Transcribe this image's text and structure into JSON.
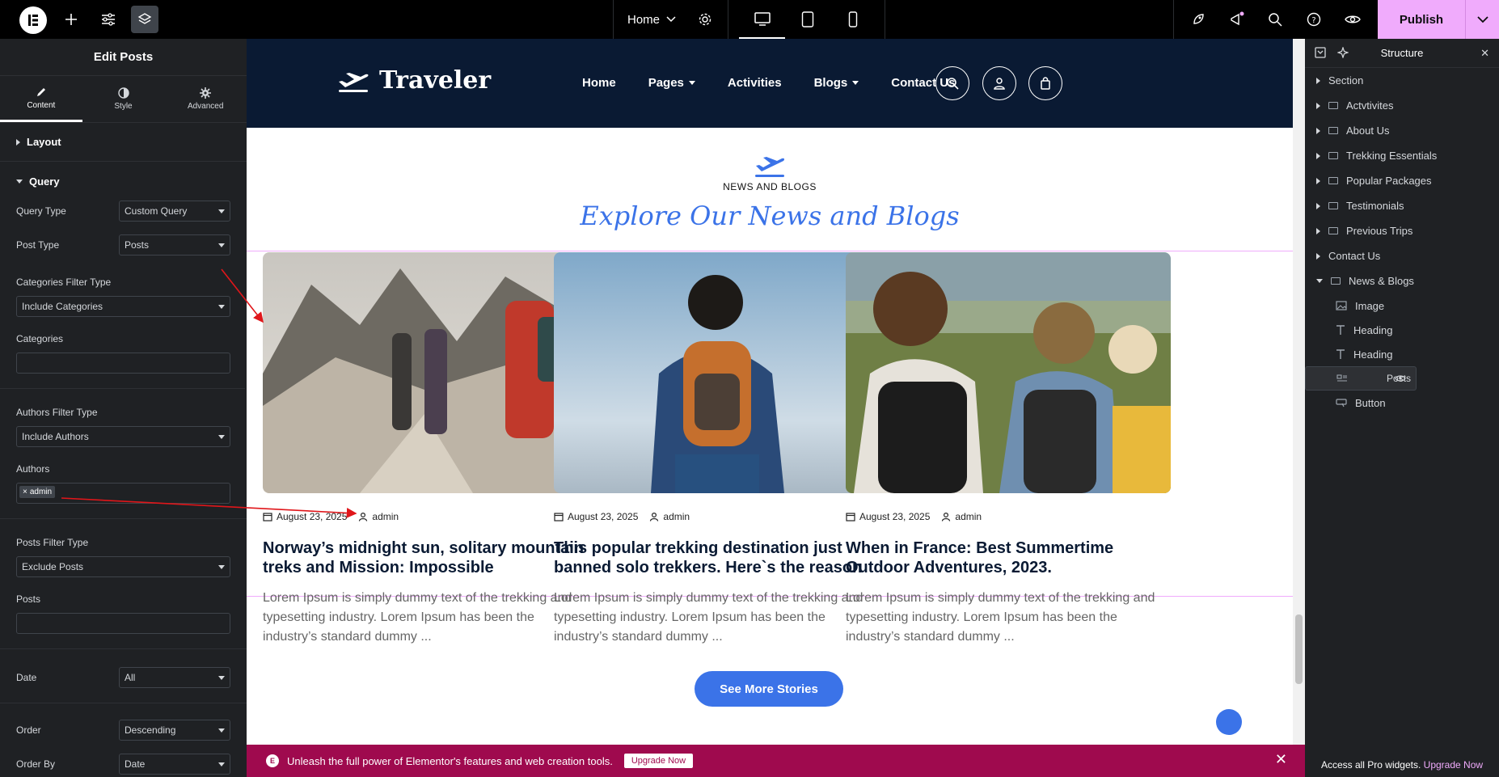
{
  "topbar": {
    "page_name": "Home",
    "publish_label": "Publish"
  },
  "left_panel": {
    "title": "Edit Posts",
    "tabs": [
      {
        "label": "Content",
        "icon": "pencil-icon"
      },
      {
        "label": "Style",
        "icon": "contrast-icon"
      },
      {
        "label": "Advanced",
        "icon": "gear-icon"
      }
    ],
    "sections": {
      "layout": "Layout",
      "query": "Query"
    },
    "fields": {
      "query_type": {
        "label": "Query Type",
        "value": "Custom Query"
      },
      "post_type": {
        "label": "Post Type",
        "value": "Posts"
      },
      "categories_filter_type": {
        "label": "Categories Filter Type",
        "value": "Include Categories"
      },
      "categories": {
        "label": "Categories"
      },
      "authors_filter_type": {
        "label": "Authors Filter Type",
        "value": "Include Authors"
      },
      "authors": {
        "label": "Authors",
        "tag": "admin"
      },
      "posts_filter_type": {
        "label": "Posts Filter Type",
        "value": "Exclude Posts"
      },
      "posts": {
        "label": "Posts"
      },
      "date": {
        "label": "Date",
        "value": "All"
      },
      "order": {
        "label": "Order",
        "value": "Descending"
      },
      "order_by": {
        "label": "Order By",
        "value": "Date"
      }
    }
  },
  "site": {
    "logo_text": "Traveler",
    "nav": [
      "Home",
      "Pages",
      "Activities",
      "Blogs",
      "Contact Us"
    ],
    "section_label": "NEWS AND BLOGS",
    "section_title": "Explore Our News and Blogs",
    "cards": [
      {
        "date": "August 23, 2025",
        "author": "admin",
        "title": "Norway’s midnight sun, solitary mountain treks and Mission: Impossible",
        "excerpt": "Lorem Ipsum is simply dummy text of the trekking and typesetting industry. Lorem Ipsum has been the industry’s standard dummy ..."
      },
      {
        "date": "August 23, 2025",
        "author": "admin",
        "title": "This popular trekking destination just banned solo trekkers. Here`s the reason",
        "excerpt": "Lorem Ipsum is simply dummy text of the trekking and typesetting industry. Lorem Ipsum has been the industry’s standard dummy ..."
      },
      {
        "date": "August 23, 2025",
        "author": "admin",
        "title": "When in France: Best Summertime Outdoor Adventures, 2023.",
        "excerpt": "Lorem Ipsum is simply dummy text of the trekking and typesetting industry. Lorem Ipsum has been the industry’s standard dummy ..."
      }
    ],
    "more_button": "See More Stories"
  },
  "promo": {
    "text": "Unleash the full power of Elementor's features and web creation tools.",
    "button": "Upgrade Now"
  },
  "structure": {
    "title": "Structure",
    "items": [
      "Section",
      "Actvtivites",
      "About Us",
      "Trekking Essentials",
      "Popular Packages",
      "Testimonials",
      "Previous Trips",
      "Contact Us",
      "News & Blogs"
    ],
    "children": [
      "Image",
      "Heading",
      "Heading",
      "Posts",
      "Button"
    ],
    "footer_text": "Access all Pro widgets.",
    "footer_link": "Upgrade Now"
  },
  "colors": {
    "accent": "#3b73e8",
    "header_bg": "#0a1a33",
    "publish": "#f0abfc",
    "promo_bg": "#9f0a4e",
    "panel_bg": "#1f2124"
  }
}
